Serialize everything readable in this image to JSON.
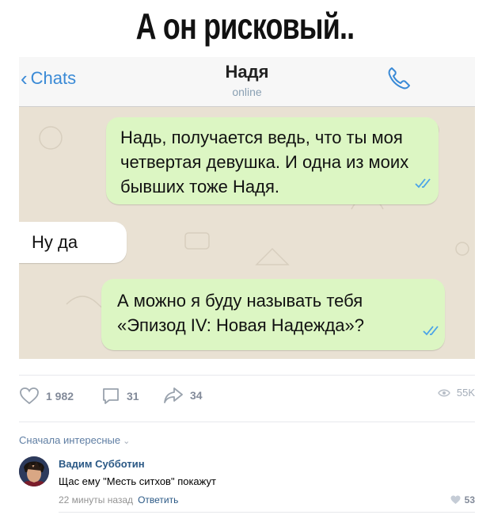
{
  "post": {
    "title": "А он рисковый..",
    "screenshot": {
      "back_label": "Chats",
      "contact_name": "Надя",
      "contact_status": "online",
      "messages": [
        {
          "side": "out",
          "text": "Надь, получается ведь, что ты моя четвертая девушка. И одна из моих бывших тоже Надя."
        },
        {
          "side": "in",
          "text": "Ну да"
        },
        {
          "side": "out",
          "text": "А можно я буду называть тебя «Эпизод IV: Новая Надежда»?"
        }
      ]
    },
    "actions": {
      "likes": "1 982",
      "comments": "31",
      "shares": "34",
      "views": "55K"
    }
  },
  "comments": {
    "sort_label": "Сначала интересные",
    "items": [
      {
        "author": "Вадим Субботин",
        "text": "Щас ему \"Месть ситхов\" покажут",
        "time": "22 минуты назад",
        "reply_label": "Ответить",
        "likes": "53"
      }
    ]
  },
  "colors": {
    "link": "#2a5885",
    "bubble_out": "#dcf6c3",
    "bubble_in": "#ffffff",
    "chat_bg": "#e9e1d3",
    "ios_blue": "#3a8ad6"
  }
}
